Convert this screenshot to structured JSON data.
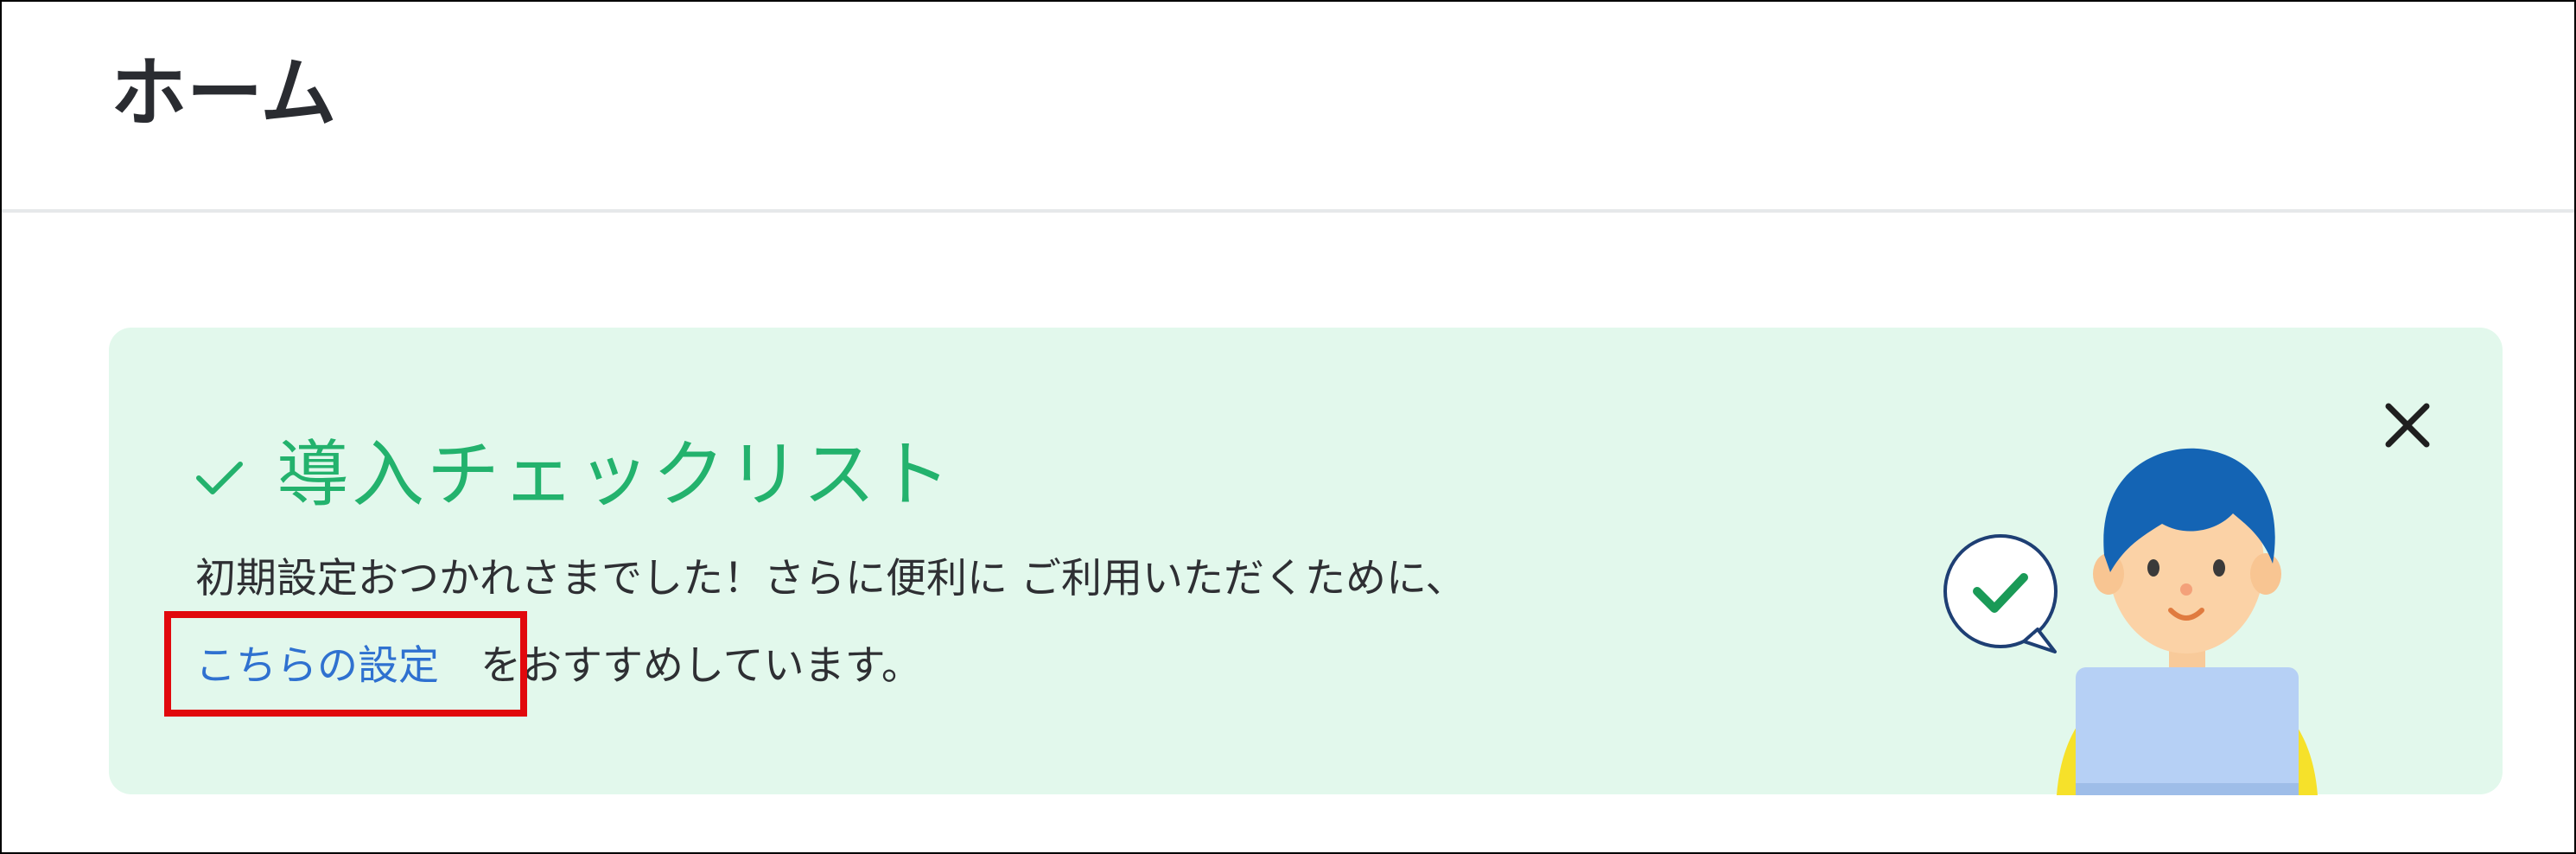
{
  "header": {
    "title": "ホーム"
  },
  "checklist_card": {
    "title": "導入チェックリスト",
    "description_line1": "初期設定おつかれさまでした！さらに便利に ご利用いただくために、",
    "link_label": "こちらの設定",
    "description_line2_suffix": "をおすすめしています。",
    "close_icon": "close-icon",
    "title_icon": "check-icon",
    "illustration_icon": "user-with-laptop-illustration",
    "speech_bubble_icon": "check-speech-bubble-icon"
  },
  "colors": {
    "card_background": "#e2f8ec",
    "title_green": "#23b26d",
    "link_blue": "#2f71d0",
    "highlight_red": "#e1090d",
    "text_dark": "#2e2f33"
  }
}
